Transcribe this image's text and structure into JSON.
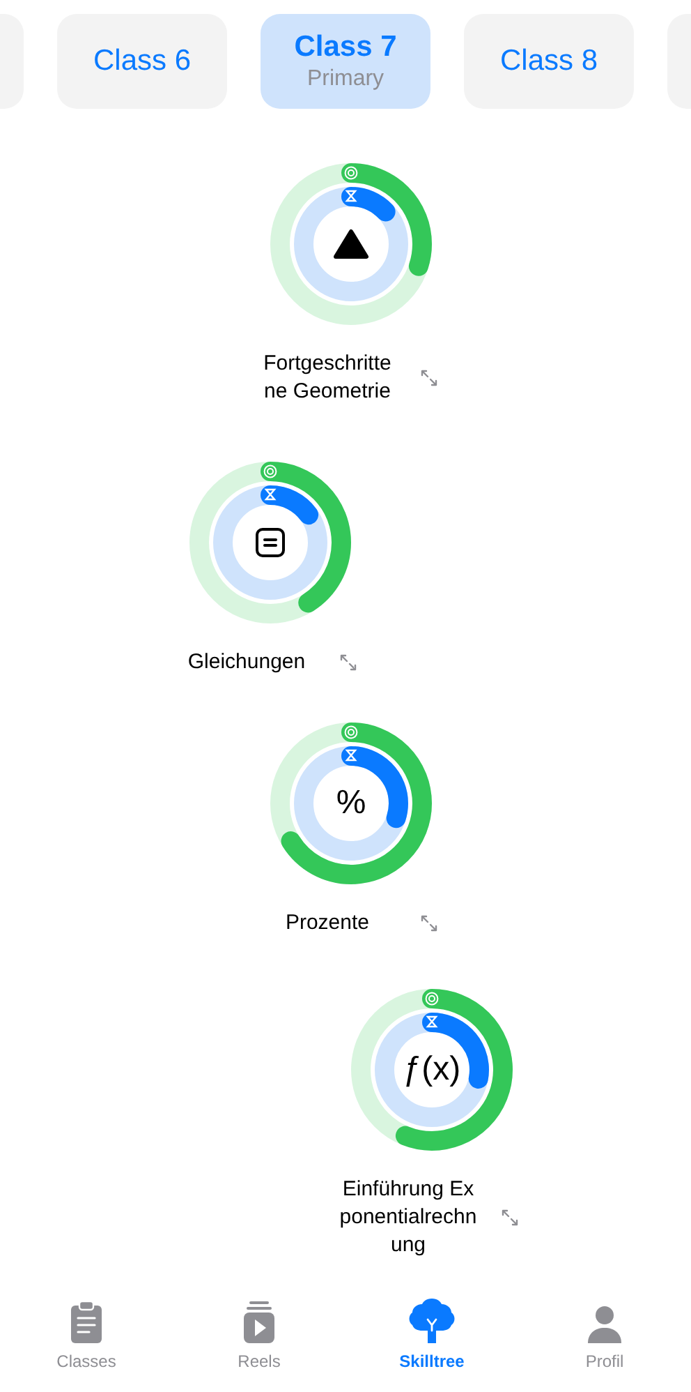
{
  "classes": [
    {
      "label": "Class 6",
      "selected": false
    },
    {
      "label": "Class 7",
      "sublabel": "Primary",
      "selected": true
    },
    {
      "label": "Class 8",
      "selected": false
    }
  ],
  "skills": [
    {
      "name": "Fortgeschrittene Geometrie",
      "kind": "triangle",
      "goal": {
        "level": 0.3
      },
      "time": {
        "level": 0.13
      }
    },
    {
      "name": "Gleichungen",
      "kind": "equation",
      "goal": {
        "level": 0.41
      },
      "time": {
        "level": 0.15
      }
    },
    {
      "name": "Prozente",
      "kind": "text",
      "symbol": "%",
      "goal": {
        "level": 0.66
      },
      "time": {
        "level": 0.3
      }
    },
    {
      "name": "Einführung Exponentialrechnung",
      "kind": "text",
      "symbol": "ƒ(x)",
      "goal": {
        "level": 0.56
      },
      "time": {
        "level": 0.28
      }
    }
  ],
  "tab_bar": [
    {
      "label": "Classes",
      "kind": "clipboard",
      "selected": false
    },
    {
      "label": "Reels",
      "kind": "play",
      "selected": false
    },
    {
      "label": "Skilltree",
      "kind": "tree",
      "selected": true
    },
    {
      "label": "Profil",
      "kind": "person",
      "selected": false
    }
  ]
}
